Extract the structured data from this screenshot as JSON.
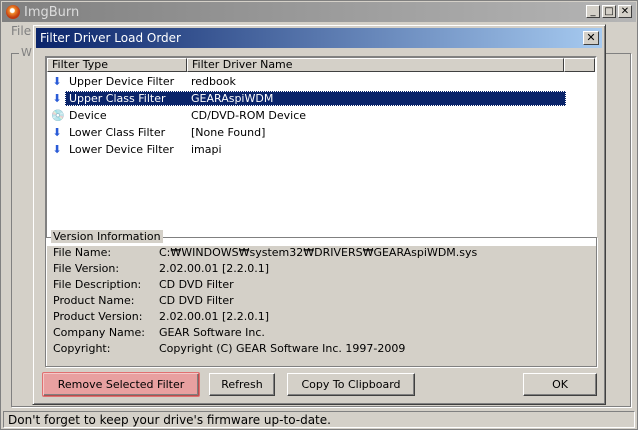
{
  "app": {
    "title": "ImgBurn",
    "menu_file": "File",
    "group_label": "WI",
    "status": "Don't forget to keep your drive's firmware up-to-date."
  },
  "titlebar_buttons": {
    "min": "_",
    "max": "□",
    "close": "✕"
  },
  "dialog": {
    "title": "Filter Driver Load Order",
    "close": "✕",
    "columns": [
      "Filter Type",
      "Filter Driver Name"
    ],
    "rows": [
      {
        "type": "Upper Device Filter",
        "name": "redbook",
        "icon": "down-arrow-icon"
      },
      {
        "type": "Upper Class Filter",
        "name": "GEARAspiWDM",
        "icon": "down-arrow-icon",
        "selected": true
      },
      {
        "type": "Device",
        "name": "CD/DVD-ROM Device",
        "icon": "cd-drive-icon"
      },
      {
        "type": "Lower Class Filter",
        "name": "[None Found]",
        "icon": "down-arrow-icon"
      },
      {
        "type": "Lower Device Filter",
        "name": "imapi",
        "icon": "down-arrow-icon"
      }
    ],
    "version": {
      "label": "Version Information",
      "fields": [
        {
          "label": "File Name:",
          "value": "C:₩WINDOWS₩system32₩DRIVERS₩GEARAspiWDM.sys"
        },
        {
          "label": "File Version:",
          "value": "2.02.00.01 [2.2.0.1]"
        },
        {
          "label": "File Description:",
          "value": "CD DVD Filter"
        },
        {
          "label": "Product Name:",
          "value": "CD DVD Filter"
        },
        {
          "label": "Product Version:",
          "value": "2.02.00.01 [2.2.0.1]"
        },
        {
          "label": "Company Name:",
          "value": "GEAR Software Inc."
        },
        {
          "label": "Copyright:",
          "value": "Copyright (C) GEAR Software Inc. 1997-2009"
        }
      ]
    },
    "buttons": {
      "remove": "Remove Selected Filter",
      "refresh": "Refresh",
      "copy": "Copy To Clipboard",
      "ok": "OK"
    }
  }
}
